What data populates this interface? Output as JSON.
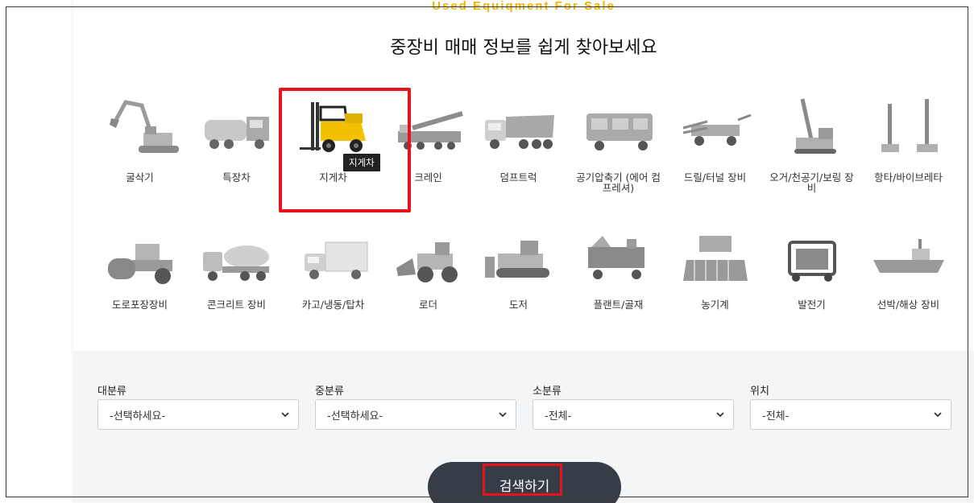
{
  "header": {
    "eyebrow": "Used Equiqment For Sale",
    "title": "중장비 매매 정보를 쉽게 찾아보세요"
  },
  "categories_row1": [
    {
      "label": "굴삭기",
      "icon": "excavator-icon"
    },
    {
      "label": "특장차",
      "icon": "special-truck-icon"
    },
    {
      "label": "지게차",
      "icon": "forklift-icon",
      "highlighted": true
    },
    {
      "label": "크레인",
      "icon": "crane-icon"
    },
    {
      "label": "덤프트럭",
      "icon": "dump-truck-icon"
    },
    {
      "label": "공기압축기 (에어 컴프레셔)",
      "icon": "air-compressor-icon"
    },
    {
      "label": "드릴/터널 장비",
      "icon": "drill-tunnel-icon"
    },
    {
      "label": "오거/천공기/보링 장비",
      "icon": "auger-drill-icon"
    },
    {
      "label": "항타/바이브레타",
      "icon": "pile-driver-icon"
    }
  ],
  "categories_row2": [
    {
      "label": "도로포장장비",
      "icon": "road-roller-icon"
    },
    {
      "label": "콘크리트 장비",
      "icon": "concrete-mixer-icon"
    },
    {
      "label": "카고/냉동/탑차",
      "icon": "cargo-truck-icon"
    },
    {
      "label": "로더",
      "icon": "loader-icon"
    },
    {
      "label": "도저",
      "icon": "dozer-icon"
    },
    {
      "label": "플랜트/골재",
      "icon": "plant-aggregate-icon"
    },
    {
      "label": "농기계",
      "icon": "farm-machine-icon"
    },
    {
      "label": "발전기",
      "icon": "generator-icon"
    },
    {
      "label": "선박/해상 장비",
      "icon": "ship-icon"
    }
  ],
  "tooltip": "지게차",
  "filters": [
    {
      "label": "대분류",
      "value": "-선택하세요-"
    },
    {
      "label": "중분류",
      "value": "-선택하세요-"
    },
    {
      "label": "소분류",
      "value": "-전체-"
    },
    {
      "label": "위치",
      "value": "-전체-"
    }
  ],
  "search_button": "검색하기",
  "colors": {
    "accent_yellow": "#f0b400",
    "highlight_red": "#e8121c",
    "button_dark": "#363d47",
    "panel_gray": "#f4f5f7"
  }
}
